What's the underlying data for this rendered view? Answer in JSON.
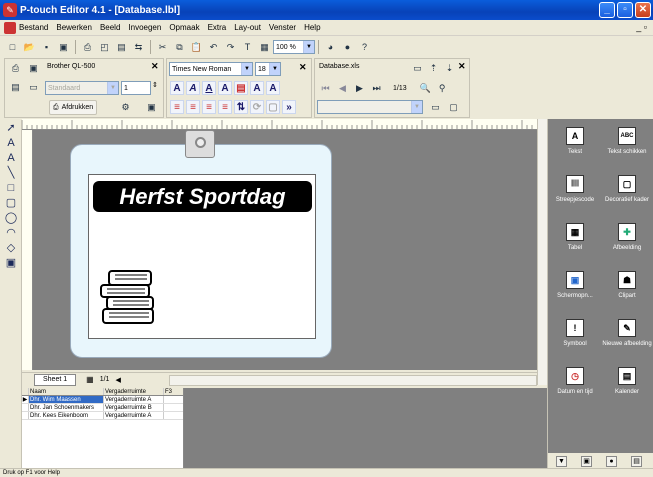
{
  "window": {
    "title": "P-touch Editor 4.1 - [Database.lbl]"
  },
  "menu": {
    "items": [
      "Bestand",
      "Bewerken",
      "Beeld",
      "Invoegen",
      "Opmaak",
      "Extra",
      "Lay-out",
      "Venster",
      "Help"
    ],
    "mdi_controls": "_ ▫"
  },
  "toolbar": {
    "zoom": "100 %",
    "printer": "Brother QL-500",
    "paper": "Standaard",
    "copies": "1",
    "print_label": "Afdrukken",
    "font_name": "Times New Roman",
    "font_size": "18",
    "database_file": "Database.xls",
    "record_counter": "1/13"
  },
  "label": {
    "banner_text": "Herfst Sportdag"
  },
  "sheets": {
    "active": "Sheet 1",
    "page_counter": "1/1"
  },
  "database": {
    "columns": [
      "Naam",
      "Vergaderruimte",
      "F3"
    ],
    "rows": [
      {
        "marker": "▶",
        "naam": "Dhr. Wim Maassen",
        "ruimte": "Vergaderruimte A",
        "f3": ""
      },
      {
        "marker": "",
        "naam": "Dhr. Jan Schoenmakers",
        "ruimte": "Vergaderruimte B",
        "f3": ""
      },
      {
        "marker": "",
        "naam": "Dhr. Kees Eikenboom",
        "ruimte": "Vergaderruimte A",
        "f3": ""
      }
    ]
  },
  "objects": [
    {
      "label": "Tekst",
      "icon": "text-icon",
      "glyph": "A"
    },
    {
      "label": "Tekst schikken",
      "icon": "text-arrange-icon",
      "glyph": "ABC"
    },
    {
      "label": "Streepjescode",
      "icon": "barcode-icon",
      "glyph": "||||"
    },
    {
      "label": "Decoratief kader",
      "icon": "frame-icon",
      "glyph": "▢"
    },
    {
      "label": "Tabel",
      "icon": "table-icon",
      "glyph": "▦"
    },
    {
      "label": "Afbeelding",
      "icon": "image-icon",
      "glyph": "✚"
    },
    {
      "label": "Schermopn...",
      "icon": "screenshot-icon",
      "glyph": "▣"
    },
    {
      "label": "Clipart",
      "icon": "clipart-icon",
      "glyph": "☗"
    },
    {
      "label": "Symbool",
      "icon": "symbol-icon",
      "glyph": "!"
    },
    {
      "label": "Nieuwe afbeelding",
      "icon": "new-image-icon",
      "glyph": "✎"
    },
    {
      "label": "Datum en tijd",
      "icon": "date-time-icon",
      "glyph": "◷"
    },
    {
      "label": "Kalender",
      "icon": "calendar-icon",
      "glyph": "▤"
    }
  ],
  "status": {
    "text": "Druk op F1 voor Help"
  }
}
